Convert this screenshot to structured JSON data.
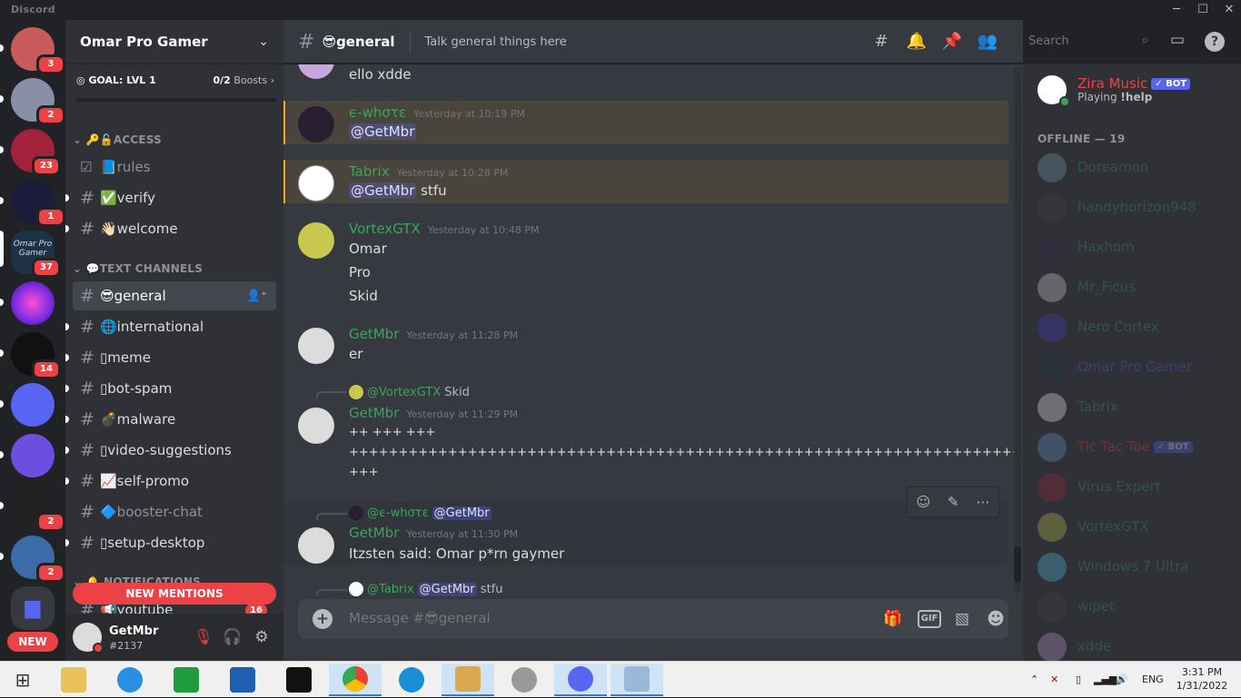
{
  "window": {
    "title": "Discord",
    "minimize": "─",
    "maximize": "☐",
    "close": "✕"
  },
  "servers": [
    {
      "name": "server-1",
      "badge": "3",
      "color": "#c85a5a"
    },
    {
      "name": "server-2",
      "badge": "2",
      "color": "#8a8fa8"
    },
    {
      "name": "server-3",
      "badge": "23",
      "color": "#a4213b"
    },
    {
      "name": "server-4",
      "badge": "1",
      "color": "#1a1c3a"
    },
    {
      "name": "Omar Pro Gamer",
      "badge": "37",
      "color": "#1d3345",
      "label": "Omar Pro Gamer"
    },
    {
      "name": "server-6",
      "badge": "",
      "color": "#7a2ae0"
    },
    {
      "name": "server-7",
      "badge": "14",
      "color": "#111"
    },
    {
      "name": "server-8",
      "badge": "",
      "color": "#5865f2"
    },
    {
      "name": "server-9",
      "badge": "",
      "color": "#6c4ee0"
    },
    {
      "name": "server-10",
      "badge": "2",
      "color": "#222"
    },
    {
      "name": "server-11",
      "badge": "2",
      "color": "#3d6ba8"
    },
    {
      "name": "server-12",
      "badge": "",
      "color": "#5865f2"
    }
  ],
  "rail_new_label": "NEW",
  "sidebar": {
    "server_name": "Omar Pro Gamer",
    "goal_label": "GOAL: LVL 1",
    "boosts_count": "0/2",
    "boosts_label": "Boosts",
    "categories": {
      "access": "🔑🔓ACCESS",
      "text": "💬TEXT CHANNELS",
      "notifications": "🔔 NOTIFICATIONS"
    },
    "channels": [
      {
        "id": "rules",
        "label": "📘rules",
        "icon": "☑"
      },
      {
        "id": "verify",
        "label": "✅verify",
        "icon": "#"
      },
      {
        "id": "welcome",
        "label": "👋🏻welcome",
        "icon": "#"
      },
      {
        "id": "general",
        "label": "😎general",
        "icon": "#"
      },
      {
        "id": "international",
        "label": "🌐international",
        "icon": "#"
      },
      {
        "id": "meme",
        "label": "▯meme",
        "icon": "#"
      },
      {
        "id": "bot-spam",
        "label": "▯bot-spam",
        "icon": "#"
      },
      {
        "id": "malware",
        "label": "💣malware",
        "icon": "#"
      },
      {
        "id": "video-suggestions",
        "label": "▯video-suggestions",
        "icon": "#"
      },
      {
        "id": "self-promo",
        "label": "📈self-promo",
        "icon": "#"
      },
      {
        "id": "booster-chat",
        "label": "🔷booster-chat",
        "icon": "#"
      },
      {
        "id": "setup-desktop",
        "label": "▯setup-desktop",
        "icon": "#"
      },
      {
        "id": "youtube",
        "label": "📢youtube",
        "icon": "#",
        "badge": "16"
      }
    ],
    "new_mentions": "NEW MENTIONS",
    "user": {
      "name": "GetMbr",
      "tag": "#2137"
    }
  },
  "channel": {
    "name": "😎general",
    "topic": "Talk general things here",
    "search_placeholder": "Search"
  },
  "messages": [
    {
      "author": "",
      "time": "",
      "lines": [
        "ello xdde"
      ]
    },
    {
      "author": "ϵ-whστε",
      "time": "Yesterday at 10:19 PM",
      "mention": "@GetMbr",
      "text": ""
    },
    {
      "author": "Tabrix",
      "time": "Yesterday at 10:28 PM",
      "mention": "@GetMbr",
      "text": "stfu"
    },
    {
      "author": "VortexGTX",
      "time": "Yesterday at 10:48 PM",
      "lines": [
        "Omar",
        "Pro",
        "Skid"
      ]
    },
    {
      "author": "GetMbr",
      "time": "Yesterday at 11:28 PM",
      "lines": [
        "er"
      ]
    },
    {
      "author": "GetMbr",
      "time": "Yesterday at 11:29 PM",
      "reply_to": "@VortexGTX",
      "reply_text": "Skid",
      "lines": [
        "++ +++ +++",
        "++++++++++++++++++++++++++++++++++++++++++++++++++++++++++++++++++++++++++",
        "+++"
      ]
    },
    {
      "author": "GetMbr",
      "time": "Yesterday at 11:30 PM",
      "reply_to": "@ϵ-whστε",
      "reply_mention": "@GetMbr",
      "lines": [
        "Itzsten said: Omar p*rn gaymer"
      ]
    },
    {
      "author": "",
      "time": "",
      "reply_to": "@Tabrix",
      "reply_mention": "@GetMbr",
      "reply_text": "stfu"
    }
  ],
  "composer": {
    "placeholder": "Message #😎general",
    "gif": "GIF"
  },
  "members": {
    "online_bot": {
      "name": "Zira Music",
      "badge": "✓ BOT",
      "status_prefix": "Playing",
      "status_game": "!help"
    },
    "offline_header": "OFFLINE — 19",
    "offline": [
      {
        "name": "Doreamon",
        "color": "#7fa6b8"
      },
      {
        "name": "handyhorizon948",
        "color": "#444"
      },
      {
        "name": "Haxhom",
        "color": "#3b2a4d"
      },
      {
        "name": "Mr_Ficus",
        "color": "#ddd"
      },
      {
        "name": "Nero Cortex",
        "color": "#4a3dd0"
      },
      {
        "name": "Omar Pro Gamer",
        "color": "#1d3345",
        "accent": "#5865f2"
      },
      {
        "name": "Tabrix",
        "color": "#fff"
      },
      {
        "name": "Tic Tac Toe",
        "color": "#6aa0d8",
        "accent": "#ed4245",
        "bot": "✓ BOT"
      },
      {
        "name": "Virus Expert",
        "color": "#a4213b"
      },
      {
        "name": "VortexGTX",
        "color": "#c8c850"
      },
      {
        "name": "Windows 7 Ultra",
        "color": "#55c8f0"
      },
      {
        "name": "wipet",
        "color": "#444"
      },
      {
        "name": "xdde",
        "color": "#c8a6e0"
      }
    ]
  },
  "taskbar": {
    "lang": "ENG",
    "time": "3:31 PM",
    "date": "1/31/2022"
  }
}
